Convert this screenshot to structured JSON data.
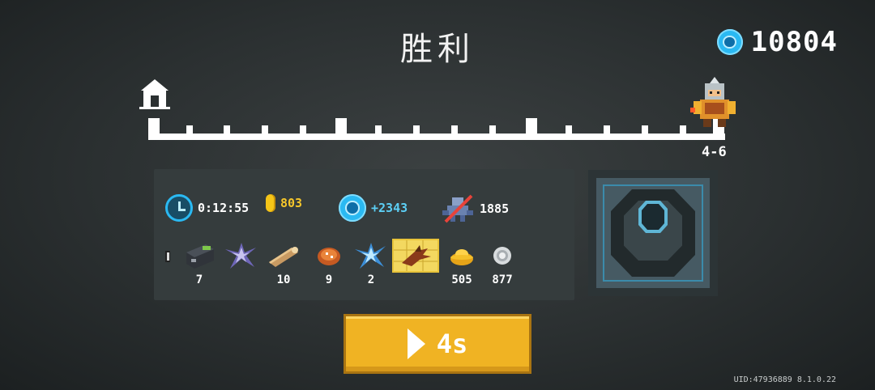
{
  "title": "胜利",
  "currency": {
    "gems": "10804",
    "icon": "gem-icon"
  },
  "progress": {
    "level": "4-6",
    "start_icon": "home-icon",
    "player_icon": "knight-avatar",
    "completed_fraction": 1.0
  },
  "stats": {
    "time": "0:12:55",
    "gold": "803",
    "gems_earned": "+2343",
    "kills": "1885"
  },
  "items": [
    {
      "icon": "partial-item-icon",
      "count": ""
    },
    {
      "icon": "battery-block-icon",
      "count": "7"
    },
    {
      "icon": "dark-crystal-icon",
      "count": ""
    },
    {
      "icon": "wood-log-icon",
      "count": "10"
    },
    {
      "icon": "meat-icon",
      "count": "9"
    },
    {
      "icon": "ice-crystal-icon",
      "count": "2"
    },
    {
      "icon": "dragon-blueprint-icon",
      "count": ""
    },
    {
      "icon": "gold-ingot-icon",
      "count": "505"
    },
    {
      "icon": "silver-coin-icon",
      "count": "877"
    }
  ],
  "chest": {
    "icon": "treasure-chest-icon"
  },
  "continue_button": {
    "label": "4s",
    "icon": "play-icon"
  },
  "uid": "UID:47936889 8.1.0.22",
  "colors": {
    "gem": "#2ab9f2",
    "gold": "#f5c518",
    "button": "#f0b323",
    "gem_text": "#5ccff5",
    "gold_text": "#f7c72b"
  }
}
